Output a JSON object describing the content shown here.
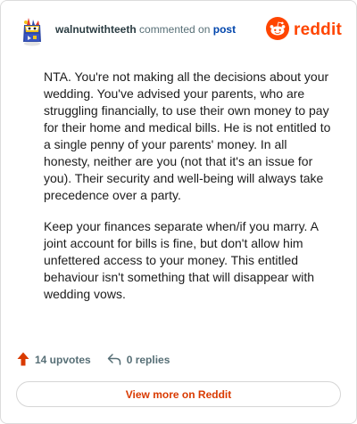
{
  "comment": {
    "author": "walnutwithteeth",
    "action_text": "commented on",
    "post_link": "post",
    "brand": "reddit",
    "paragraphs": [
      "NTA. You're not making all the decisions about your wedding. You've advised your parents, who are struggling financially, to use their own money to pay for their home and medical bills. He is not entitled to a single penny of your parents' money. In all honesty, neither are you (not that it's an issue for you). Their security and well-being will always take precedence over a party.",
      "Keep your finances separate when/if you marry. A joint account for bills is fine, but don't allow him unfettered access to your money. This entitled behaviour isn't something that will disappear with wedding vows."
    ]
  },
  "footer": {
    "upvotes": "14 upvotes",
    "replies": "0 replies",
    "view_more": "View more on Reddit"
  },
  "colors": {
    "brand": "#ff4500",
    "link": "#0045ac",
    "button_text": "#d93a00"
  },
  "icons": [
    "avatar",
    "reddit-snoo-icon",
    "upvote-arrow-icon",
    "reply-icon"
  ]
}
